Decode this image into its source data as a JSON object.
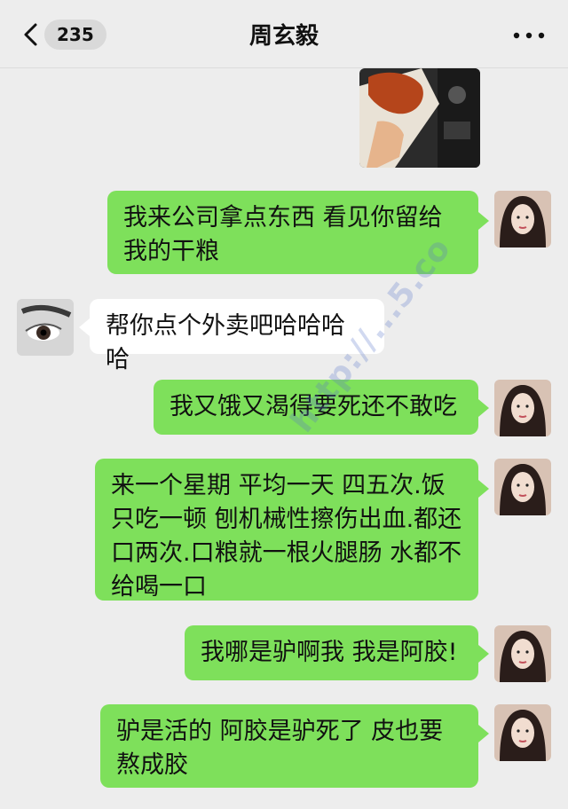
{
  "header": {
    "back_label": "",
    "unread_count": "235",
    "title": "周玄毅",
    "more_icon": "more-dots-icon"
  },
  "messages": [
    {
      "sender": "me",
      "type": "image"
    },
    {
      "sender": "me",
      "text": "我来公司拿点东西 看见你留给我的干粮"
    },
    {
      "sender": "them",
      "text": "帮你点个外卖吧哈哈哈哈"
    },
    {
      "sender": "me",
      "text": "我又饿又渴得要死还不敢吃"
    },
    {
      "sender": "me",
      "text": "来一个星期 平均一天 四五次.饭只吃一顿 刨机械性擦伤出血.都还口两次.口粮就一根火腿肠 水都不给喝一口"
    },
    {
      "sender": "me",
      "text": "我哪是驴啊我 我是阿胶!"
    },
    {
      "sender": "me",
      "text": "驴是活的 阿胶是驴死了 皮也要熬成胶"
    }
  ],
  "watermark": "http://...5.co",
  "colors": {
    "background": "#ededed",
    "my_bubble": "#7ee05b",
    "their_bubble": "#ffffff"
  }
}
